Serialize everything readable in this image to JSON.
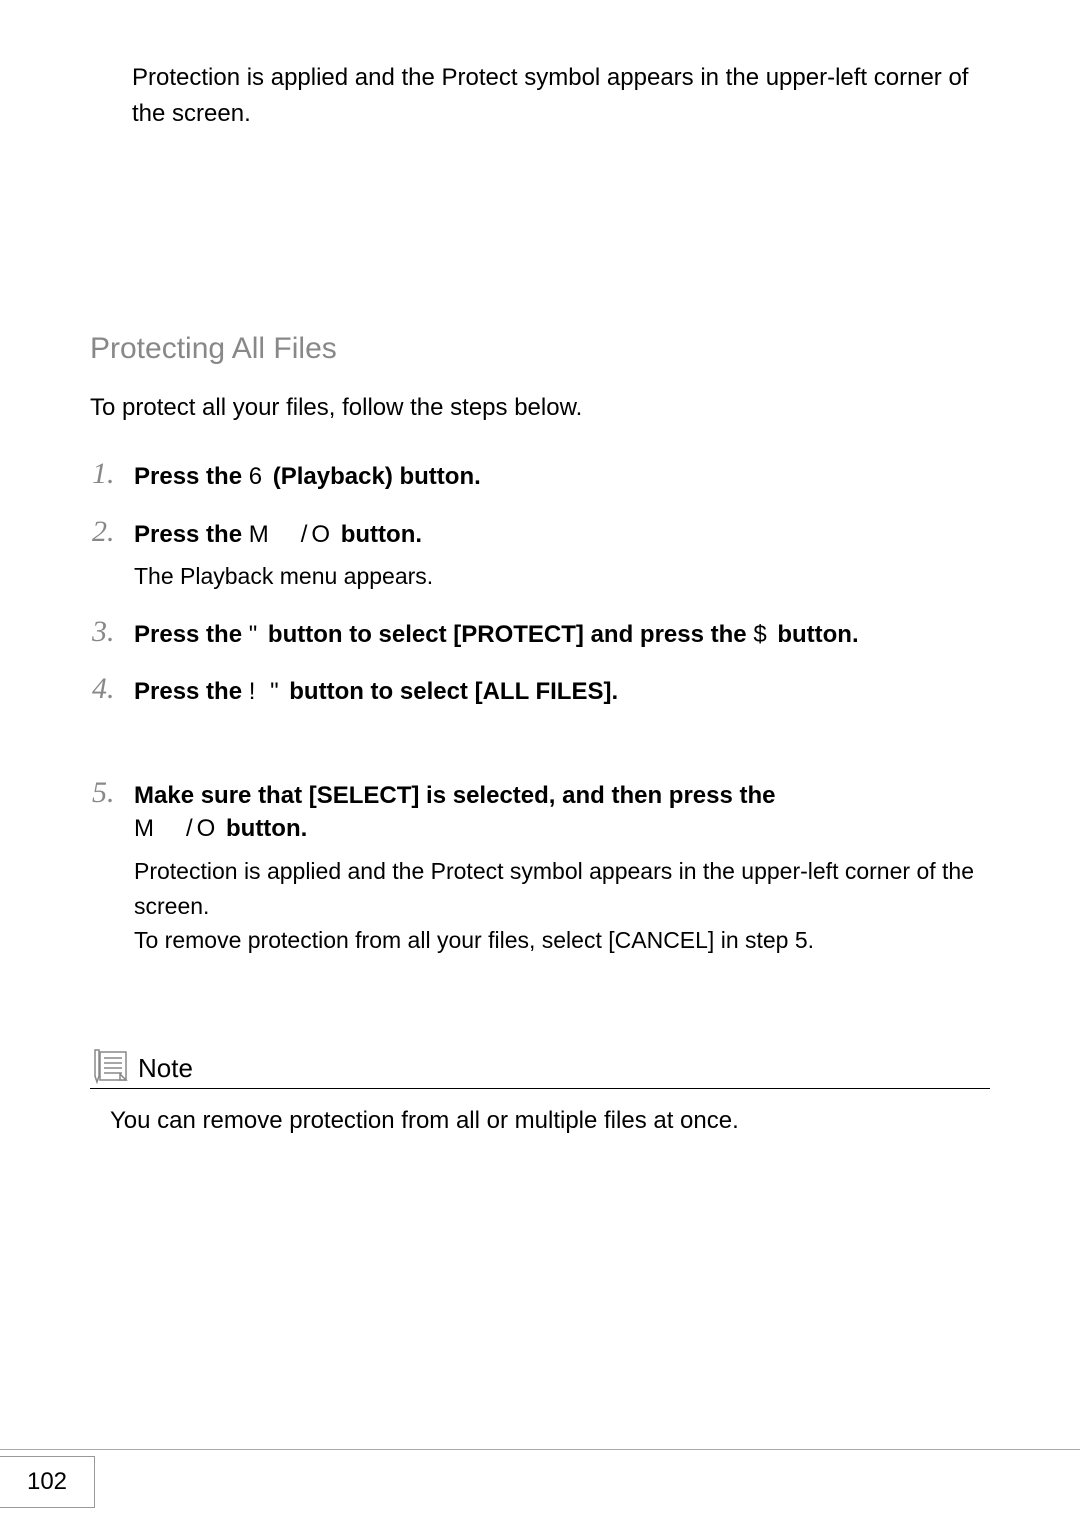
{
  "intro": "Protection is applied and the Protect symbol appears in the upper-left corner of the screen.",
  "section_heading": "Protecting All Files",
  "section_lead": "To protect all your files, follow the steps below.",
  "steps": [
    {
      "num": "1.",
      "title_pre": "Press the ",
      "glyph": "6",
      "title_post": " (Playback) button.",
      "body": ""
    },
    {
      "num": "2.",
      "title_pre": "Press the ",
      "glyph": "M /O",
      "title_post": " button.",
      "body": "The Playback menu appears."
    },
    {
      "num": "3.",
      "title_pre": "Press the ",
      "glyph": "\"",
      "title_mid": " button to select [PROTECT] and press the ",
      "glyph2": "$",
      "title_post": " button.",
      "body": ""
    },
    {
      "num": "4.",
      "title_pre": "Press the ",
      "glyph": "! \"",
      "title_post": " button to select [ALL FILES].",
      "body": ""
    },
    {
      "num": "5.",
      "title_pre": "Make sure that [SELECT] is selected, and then press the ",
      "glyph": "M /O",
      "title_post": " button.",
      "body": "Protection is applied and the Protect symbol appears in the upper-left corner of the screen.\nTo remove protection from all your files, select [CANCEL] in step 5."
    }
  ],
  "note_label": "Note",
  "note_text": "You can remove protection from all or multiple files at once.",
  "page_number": "102"
}
